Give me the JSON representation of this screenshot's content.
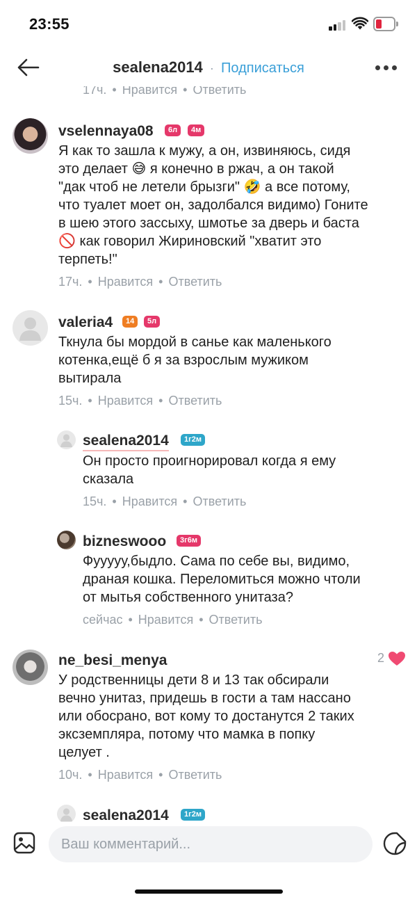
{
  "status_bar": {
    "time": "23:55",
    "battery_color": "#e0243e",
    "signal_color": "#1a1a1a"
  },
  "header": {
    "username": "sealena2014",
    "separator": "·",
    "follow_label": "Подписаться",
    "back_icon": "arrow-left-icon",
    "more_icon": "more-dots-icon"
  },
  "partial_top": {
    "time": "17ч.",
    "like": "Нравится",
    "reply": "Ответить"
  },
  "comments": [
    {
      "username": "vselennaya08",
      "badges": [
        {
          "label": "6л",
          "color": "#e5386a"
        },
        {
          "label": "4м",
          "color": "#e5386a"
        }
      ],
      "lines": [
        "Я как то зашла к мужу, а он, извиняюсь, сидя",
        "это делает 😅 я конечно в ржач, а он такой",
        "\"дак чтоб не летели брызги\" 🤣 а все потому,",
        "что туалет моет он, задолбался видимо) Гоните",
        "в шею этого зассыху, шмотье за дверь и баста",
        "🚫 как говорил Жириновский \"хватит это",
        "терпеть!\""
      ],
      "time": "17ч.",
      "like": "Нравится",
      "reply": "Ответить"
    },
    {
      "username": "valeria4",
      "badges": [
        {
          "label": "14",
          "color": "#ef7d22"
        },
        {
          "label": "5л",
          "color": "#e5386a"
        }
      ],
      "lines": [
        "Ткнула бы мордой в санье как маленького",
        "котенка,ещё б я за взрослым мужиком",
        "вытирала"
      ],
      "time": "15ч.",
      "like": "Нравится",
      "reply": "Ответить"
    },
    {
      "username": "sealena2014",
      "badges": [
        {
          "label": "1г2м",
          "color": "#2ea6c9"
        }
      ],
      "lines": [
        "Он просто проигнорировал когда я ему",
        "сказала"
      ],
      "time": "15ч.",
      "like": "Нравится",
      "reply": "Ответить"
    },
    {
      "username": "bizneswooo",
      "badges": [
        {
          "label": "3г6м",
          "color": "#e5386a"
        }
      ],
      "lines": [
        "Фууууу,быдло. Сама по себе вы, видимо,",
        "драная кошка. Переломиться можно чтоли",
        "от мытья собственного унитаза?"
      ],
      "time": "сейчас",
      "like": "Нравится",
      "reply": "Ответить"
    },
    {
      "username": "ne_besi_menya",
      "badges": [],
      "likes_count": "2",
      "lines": [
        "У родственницы дети 8 и 13 так обсирали",
        "вечно унитаз, придешь в гости а там нассано",
        "или обосрано, вот кому то достанутся 2 таких",
        "эксземпляра, потому что мамка в попку",
        "целует ."
      ],
      "time": "10ч.",
      "like": "Нравится",
      "reply": "Ответить"
    },
    {
      "username": "sealena2014",
      "badges": [
        {
          "label": "1г2м",
          "color": "#2ea6c9"
        }
      ],
      "lines": [],
      "time": "",
      "like": "",
      "reply": ""
    }
  ],
  "composer": {
    "placeholder": "Ваш комментарий...",
    "image_icon": "image-icon",
    "sticker_icon": "sticker-icon"
  },
  "colors": {
    "accent": "#3a9fd8",
    "heart": "#f04a72",
    "meta_text": "#9aa1a8"
  }
}
